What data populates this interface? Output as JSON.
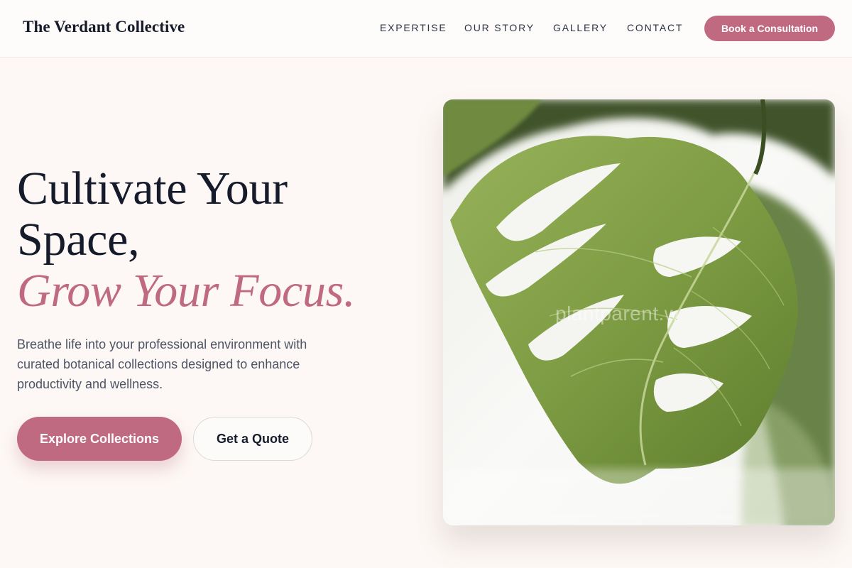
{
  "brand": {
    "name": "The Verdant Collective"
  },
  "nav": {
    "items": [
      {
        "label": "EXPERTISE"
      },
      {
        "label": "OUR STORY"
      },
      {
        "label": "GALLERY"
      },
      {
        "label": "CONTACT"
      }
    ],
    "cta_label": "Book a Consultation"
  },
  "hero": {
    "headline_line1": "Cultivate Your",
    "headline_line2": "Space,",
    "headline_accent": "Grow Your Focus.",
    "subcopy": "Breathe life into your professional environment with curated botanical collections designed to enhance productivity and wellness.",
    "primary_button": "Explore Collections",
    "secondary_button": "Get a Quote",
    "image": {
      "subject": "monstera leaf photograph",
      "watermark": "plantparent.w"
    }
  },
  "colors": {
    "accent": "#c06a82",
    "background": "#fdf8f5",
    "heading": "#151b2b",
    "body_text": "#4d5466"
  }
}
